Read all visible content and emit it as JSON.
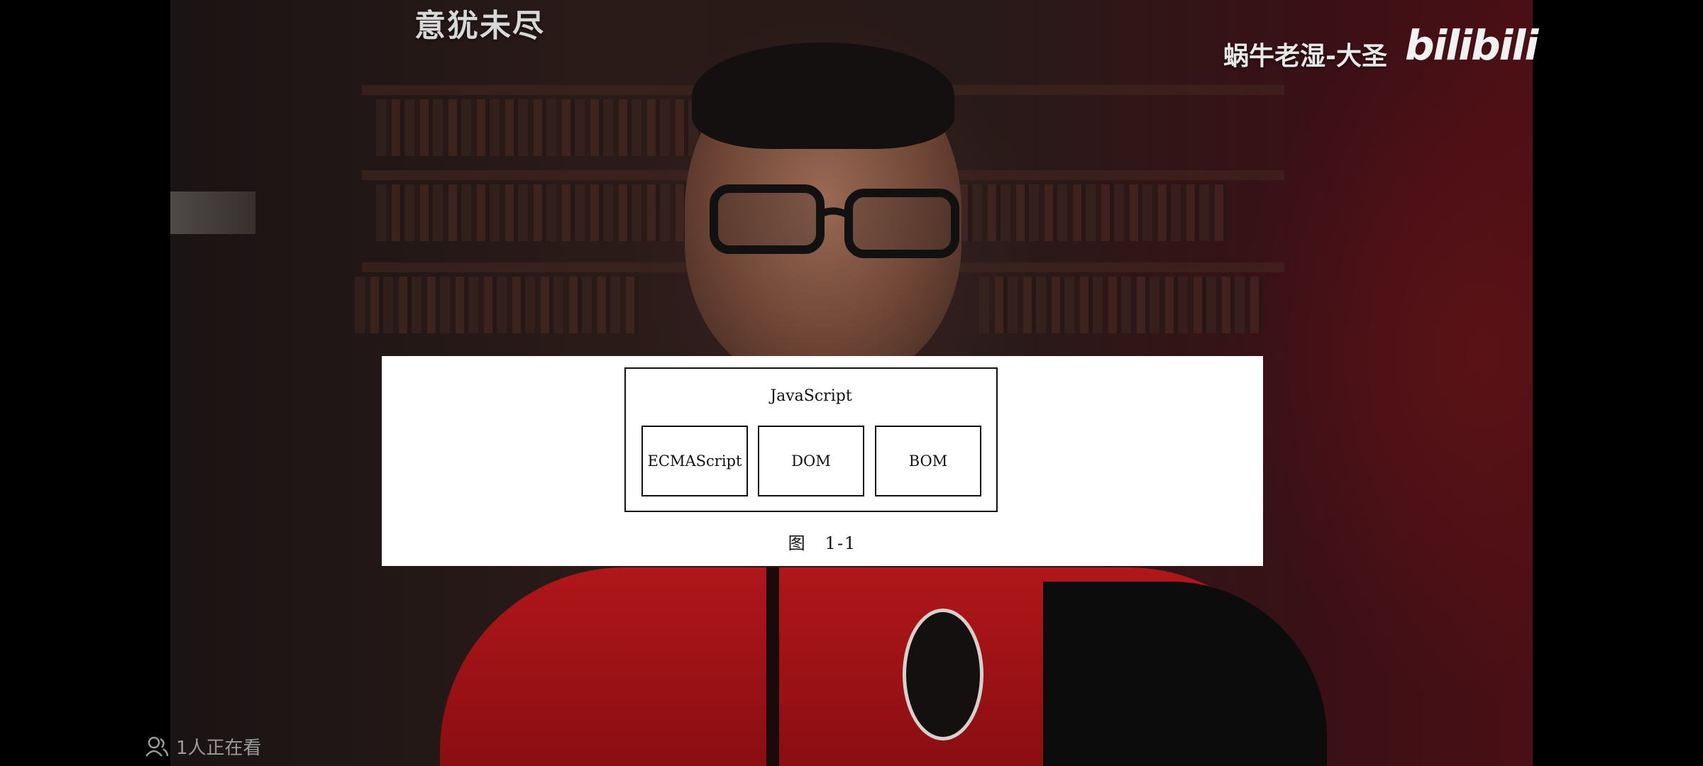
{
  "overlay": {
    "corner_title": "意犹未尽",
    "watermark": "蜗牛老湿-大圣",
    "platform_logo": "bilibili"
  },
  "diagram": {
    "outer_label": "JavaScript",
    "components": [
      "ECMAScript",
      "DOM",
      "BOM"
    ],
    "caption": "图　1-1"
  },
  "status": {
    "viewers": "1人正在看",
    "viewers_icon": "people-icon"
  }
}
